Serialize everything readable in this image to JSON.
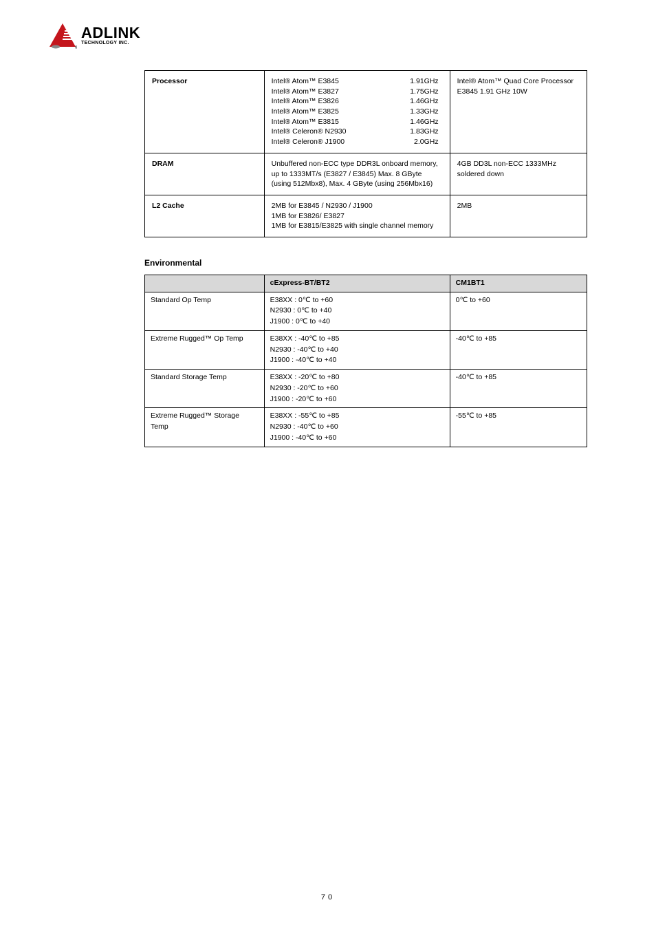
{
  "logo": {
    "main": "ADLINK",
    "sub": "TECHNOLOGY INC."
  },
  "spec_table": [
    {
      "label": "Processor",
      "center_lines": [
        {
          "name": "Intel® Atom™ E3845",
          "val": "1.91GHz"
        },
        {
          "name": "Intel® Atom™ E3827",
          "val": "1.75GHz"
        },
        {
          "name": "Intel® Atom™ E3826",
          "val": "1.46GHz"
        },
        {
          "name": "Intel® Atom™ E3825",
          "val": "1.33GHz"
        },
        {
          "name": "Intel® Atom™ E3815",
          "val": "1.46GHz"
        },
        {
          "name": "Intel® Celeron® N2930",
          "val": "1.83GHz"
        },
        {
          "name": "Intel® Celeron® J1900",
          "val": "2.0GHz"
        }
      ],
      "right": "Intel® Atom™ Quad Core Processor E3845 1.91 GHz 10W"
    },
    {
      "label": "DRAM",
      "center_text": "Unbuffered non-ECC type DDR3L onboard memory, up to 1333MT/s (E3827 / E3845) Max. 8 GByte (using 512Mbx8), Max. 4 GByte (using 256Mbx16)",
      "right": "4GB DD3L non-ECC 1333MHz soldered down"
    },
    {
      "label": "L2 Cache",
      "center_lines_plain": [
        "2MB for E3845 / N2930 / J1900",
        "1MB for E3826/ E3827",
        "1MB for E3815/E3825 with single channel memory"
      ],
      "right": "2MB"
    }
  ],
  "env_title": "Environmental",
  "env_headers": [
    "",
    "cExpress-BT/BT2",
    "CM1BT1"
  ],
  "env_rows": [
    {
      "label": "Standard Op Temp",
      "col2": [
        "E38XX : 0℃ to +60",
        "N2930 : 0℃ to +40",
        "J1900 : 0℃ to +40"
      ],
      "col3": "0℃ to +60"
    },
    {
      "label": "Extreme Rugged™ Op Temp",
      "col2": [
        "E38XX : -40℃ to +85",
        "N2930 : -40℃ to +40",
        "J1900 : -40℃ to +40"
      ],
      "col3": "-40℃ to +85"
    },
    {
      "label": "Standard Storage Temp",
      "col2": [
        "E38XX : -20℃ to +80",
        "N2930 : -20℃ to +60",
        "J1900  : -20℃ to +60"
      ],
      "col3": "-40℃ to +85"
    },
    {
      "label": "Extreme Rugged™ Storage Temp",
      "col2": [
        "E38XX : -55℃ to +85",
        "N2930 : -40℃ to +60",
        "J1900 : -40℃ to +60"
      ],
      "col3": "-55℃ to +85"
    }
  ],
  "page_number": "70"
}
